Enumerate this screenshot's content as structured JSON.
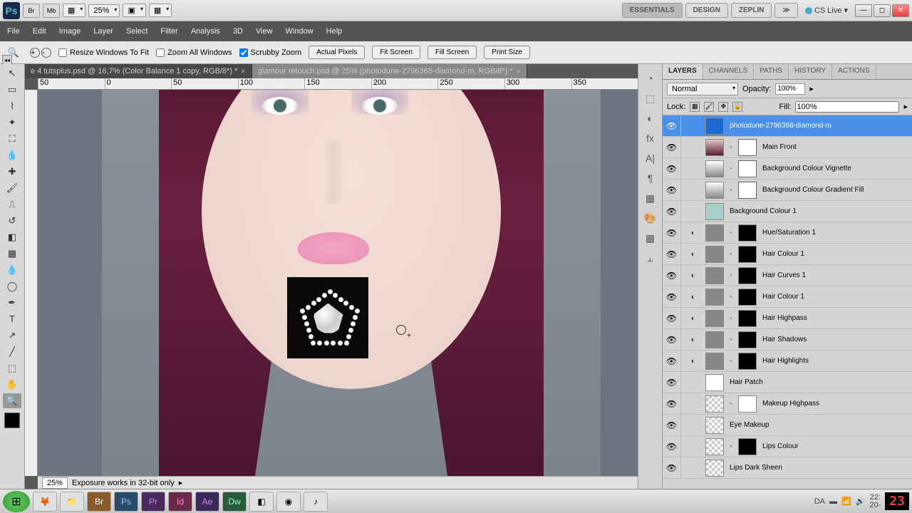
{
  "topbar": {
    "app": "Ps",
    "mini": [
      "Br",
      "Mb"
    ],
    "zoom": "25%",
    "workspaces": [
      "ESSENTIALS",
      "DESIGN",
      "ZEPLIN"
    ],
    "cslive": "CS Live"
  },
  "menu": [
    "File",
    "Edit",
    "Image",
    "Layer",
    "Select",
    "Filter",
    "Analysis",
    "3D",
    "View",
    "Window",
    "Help"
  ],
  "options": {
    "resize": "Resize Windows To Fit",
    "zoomall": "Zoom All Windows",
    "scrubby": "Scrubby Zoom",
    "btns": [
      "Actual Pixels",
      "Fit Screen",
      "Fill Screen",
      "Print Size"
    ]
  },
  "tabs": [
    "e 4 tutsplus.psd @ 16,7% (Color Balance 1 copy, RGB/8*) *",
    "glamour retouch.psd @ 25% (photodune-2796368-diamond-m, RGB/8*) *"
  ],
  "ruler": [
    "50",
    "0",
    "50",
    "100",
    "150",
    "200",
    "250",
    "300",
    "350"
  ],
  "statusbar": {
    "pct": "25%",
    "msg": "Exposure works in 32-bit only"
  },
  "panels": {
    "tabs": [
      "LAYERS",
      "CHANNELS",
      "PATHS",
      "HISTORY",
      "ACTIONS"
    ],
    "blend": "Normal",
    "opacity_lbl": "Opacity:",
    "opacity": "100%",
    "lock_lbl": "Lock:",
    "fill_lbl": "Fill:",
    "fill": "100%"
  },
  "layers": [
    {
      "name": "photodune-2796368-diamond-m",
      "sel": true,
      "t": "diamond",
      "eye": true
    },
    {
      "name": "Main Front",
      "t": "portrait-t",
      "mask": "white-m",
      "eye": true
    },
    {
      "name": "Background Colour Vignette",
      "t": "gradient",
      "mask": "white-m",
      "eye": true
    },
    {
      "name": "Background Colour Gradient Fill",
      "t": "gradient",
      "mask": "white-m",
      "eye": true
    },
    {
      "name": "Background Colour 1",
      "t": "cyan",
      "eye": true
    },
    {
      "name": "Hue/Saturation 1",
      "t": "gray",
      "fx": true,
      "mask": "black-m",
      "eye": true
    },
    {
      "name": "Hair Colour 1",
      "t": "gray",
      "fx": true,
      "mask": "black-m",
      "eye": true
    },
    {
      "name": "Hair Curves 1",
      "t": "gray",
      "fx": true,
      "mask": "black-m",
      "eye": true
    },
    {
      "name": "Hair Colour 1",
      "t": "gray",
      "fx": true,
      "mask": "black-m",
      "eye": true
    },
    {
      "name": "Hair Highpass",
      "t": "gray",
      "fx": true,
      "mask": "black-m",
      "eye": true
    },
    {
      "name": "Hair Shadows",
      "t": "gray",
      "fx": true,
      "mask": "black-m",
      "eye": true
    },
    {
      "name": "Hair Highlights",
      "t": "gray",
      "fx": true,
      "mask": "black-m",
      "eye": true
    },
    {
      "name": "Hair Patch",
      "t": "white",
      "eye": true
    },
    {
      "name": "Makeup Highpass",
      "t": "checker",
      "mask": "white",
      "eye": true
    },
    {
      "name": "Eye Makeup",
      "t": "checker",
      "eye": true
    },
    {
      "name": "Lips Colour",
      "t": "checker",
      "mask": "black-m",
      "eye": true
    },
    {
      "name": "Lips Dark Sheen",
      "t": "checker",
      "eye": true
    }
  ],
  "tray": {
    "lang": "DA",
    "time": "22:",
    "date": "20-",
    "big": "23"
  }
}
